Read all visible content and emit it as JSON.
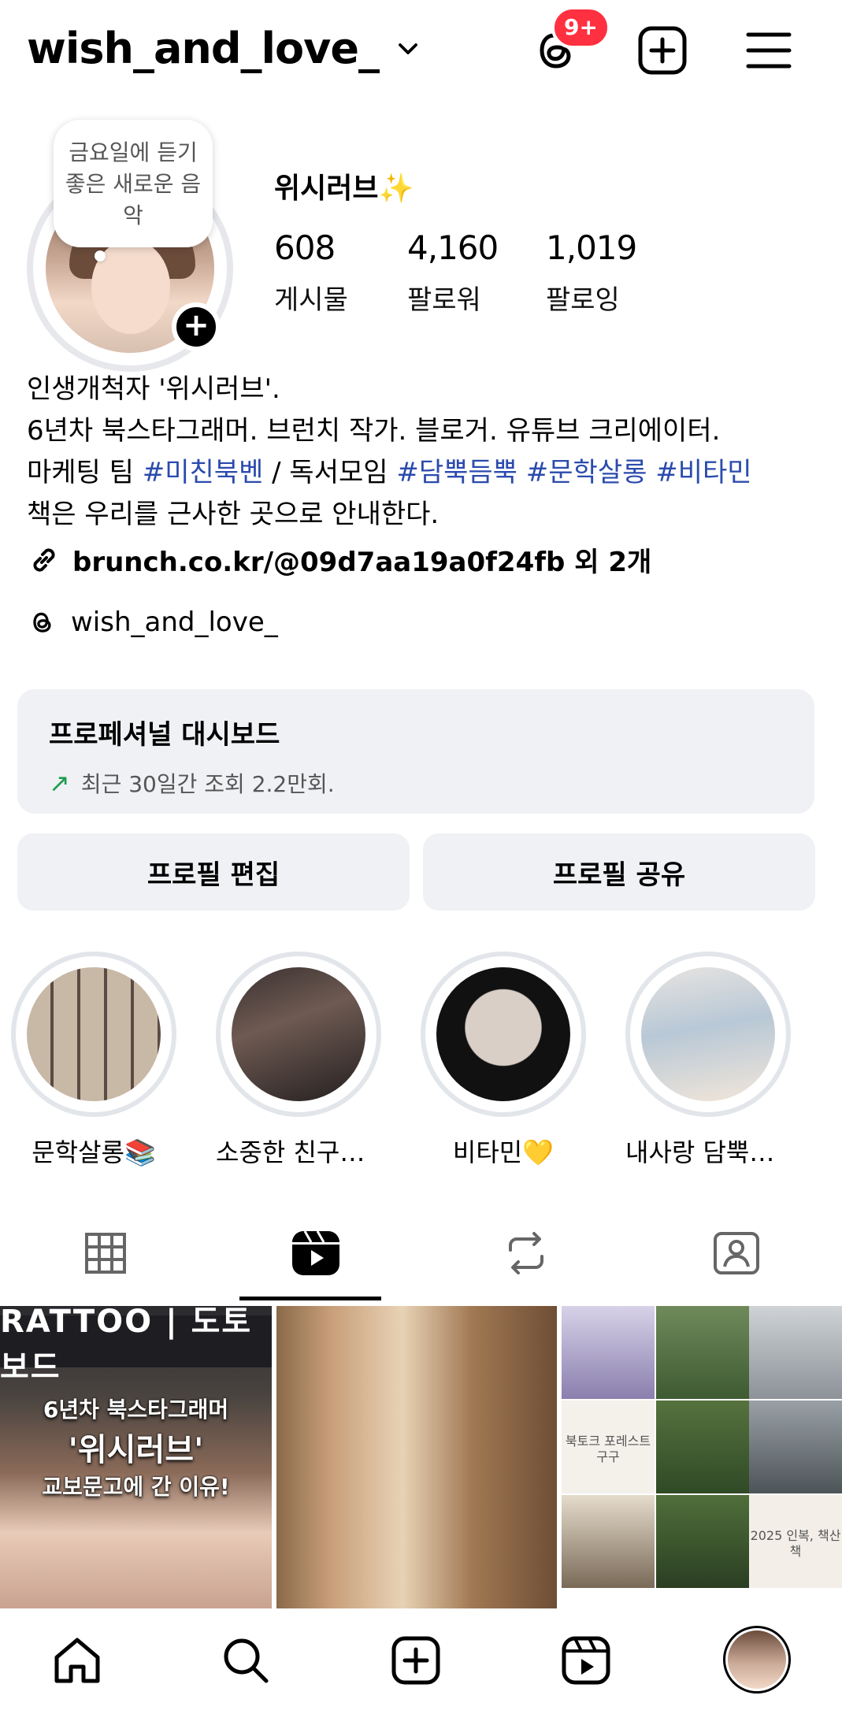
{
  "header": {
    "username": "wish_and_love_",
    "notification_badge": "9+",
    "icons": [
      "chevron-down-icon",
      "threads-icon",
      "add-post-icon",
      "menu-icon"
    ]
  },
  "profile": {
    "note": "금요일에 듣기 좋은 새로운 음악",
    "display_name": "위시러브✨",
    "stats": [
      {
        "value": "608",
        "label": "게시물"
      },
      {
        "value": "4,160",
        "label": "팔로워"
      },
      {
        "value": "1,019",
        "label": "팔로잉"
      }
    ],
    "bio": {
      "line1": "인생개척자 '위시러브'.",
      "line2": "6년차 북스타그래머. 브런치 작가. 블로거. 유튜브 크리에이터.",
      "line3_prefix": "마케팅 팀 ",
      "line3_tag1": "#미친북벤",
      "line3_mid": " / 독서모임 ",
      "line3_tag2": "#담뿍듬뿍",
      "line3_tag3": "#문학살롱",
      "line3_tag4": "#비타민",
      "line4": "책은 우리를 근사한 곳으로 안내한다."
    },
    "link": "brunch.co.kr/@09d7aa19a0f24fb 외 2개",
    "threads_handle": "wish_and_love_"
  },
  "dashboard": {
    "title": "프로페셔널 대시보드",
    "subtitle": "최근 30일간 조회 2.2만회."
  },
  "buttons": {
    "edit": "프로필 편집",
    "share": "프로필 공유"
  },
  "highlights": [
    {
      "name": "문학살롱📚"
    },
    {
      "name": "소중한 친구들🩷"
    },
    {
      "name": "비타민💛"
    },
    {
      "name": "내사랑 담뿍듬뿍..."
    }
  ],
  "tabs": [
    "grid-icon",
    "reels-icon",
    "reposts-icon",
    "tagged-icon"
  ],
  "posts": {
    "post1_sign": "RATTOO | 도토보드",
    "post1_line1": "6년차 북스타그래머",
    "post1_line2": "'위시러브'",
    "post1_line3": "교보문고에 간 이유!",
    "post3_text1": "북토크 포레스트 구구",
    "post3_text2": "2025 인복, 책산책"
  },
  "colors": {
    "hashtag": "#2b4bad",
    "badge": "#ff3040",
    "panel_bg": "#eff1f4",
    "trend_arrow": "#1f9c4f"
  }
}
